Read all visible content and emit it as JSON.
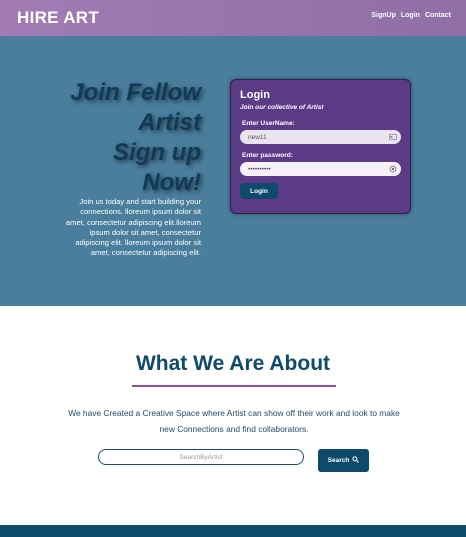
{
  "header": {
    "brand": "HIRE ART",
    "nav": [
      "SignUp",
      "Login",
      "Contact"
    ]
  },
  "hero": {
    "title_lines": [
      "Join Fellow",
      "Artist",
      "Sign up",
      "Now!"
    ],
    "text": "Join us today and start building your connections. lloreum ipsum dolor sit amet, consectetur adipiscing elit.lloreum ipsum dolor sit amet, consectetur adipiscing elit. lloreum ipsum dolor sit amet, consectetur adipiscing elit."
  },
  "login": {
    "title": "Login",
    "subtitle": "Join our collective of Artist",
    "username_label": "Enter UserName:",
    "username_value": "new11",
    "password_label": "Enter password:",
    "password_value": "••••••••••",
    "button": "Login",
    "username_icon": "id-card-icon",
    "password_icon": "eye-icon"
  },
  "about": {
    "title": "What We Are About",
    "text": "We have Created a Creative Space where Artist can show off their work and look to make new Connections and find collaborators.",
    "search_placeholder": "SearchByArtist",
    "search_button": "Search",
    "search_icon": "magnifier-icon"
  },
  "colors": {
    "header": "#a27bb4",
    "hero_bg": "#4a7e9c",
    "card": "#5b3a86",
    "accent": "#0d4a6b",
    "rule": "#8e4fa3"
  }
}
